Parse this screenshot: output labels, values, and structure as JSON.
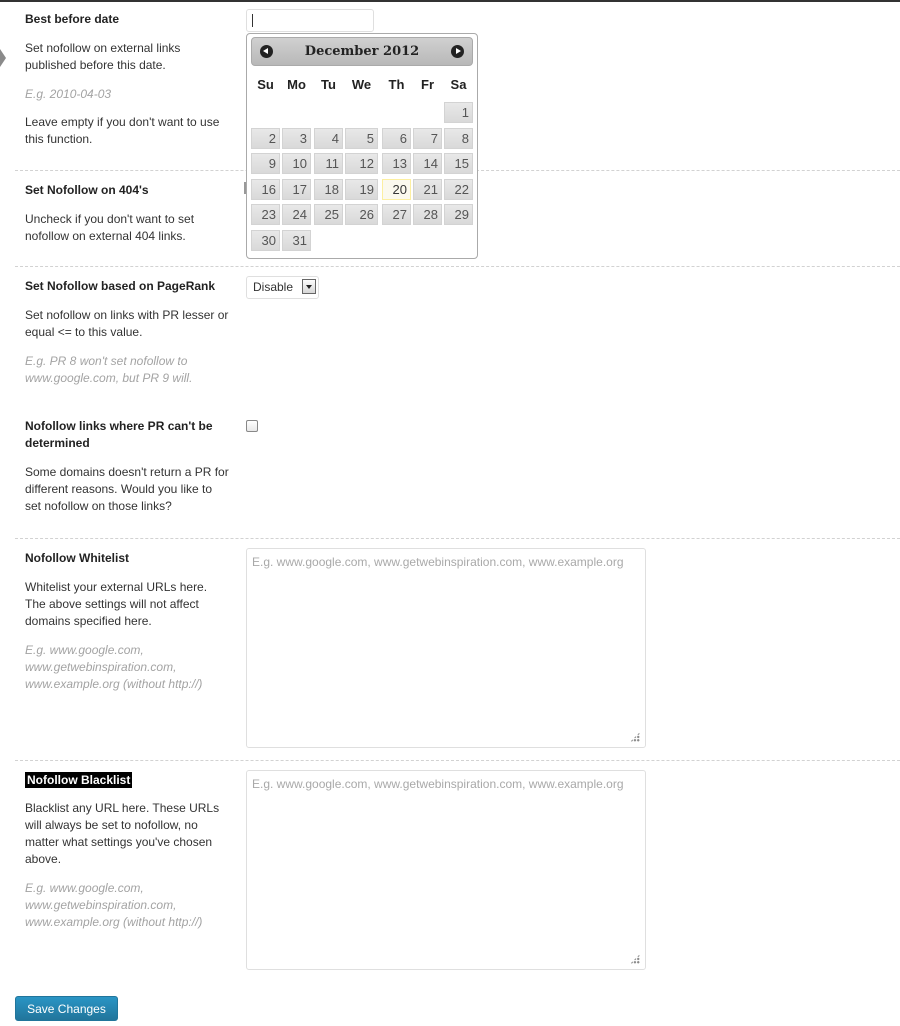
{
  "sections": {
    "best_before": {
      "title": "Best before date",
      "desc": "Set nofollow on external links published before this date.",
      "example": "E.g. 2010-04-03",
      "note": "Leave empty if you don't want to use this function.",
      "value": ""
    },
    "nofollow_404": {
      "title": "Set Nofollow on 404's",
      "desc": "Uncheck if you don't want to set nofollow on external 404 links."
    },
    "pagerank": {
      "title": "Set Nofollow based on PageRank",
      "desc": "Set nofollow on links with PR lesser or equal <= to this value.",
      "example": "E.g. PR 8 won't set nofollow to www.google.com, but PR 9 will.",
      "selected": "Disable"
    },
    "pr_undetermined": {
      "title": "Nofollow links where PR can't be determined",
      "desc": "Some domains doesn't return a PR for different reasons. Would you like to set nofollow on those links?"
    },
    "whitelist": {
      "title": "Nofollow Whitelist",
      "desc": "Whitelist your external URLs here. The above settings will not affect domains specified here.",
      "example": "E.g. www.google.com, www.getwebinspiration.com, www.example.org (without http://)",
      "placeholder": "E.g. www.google.com, www.getwebinspiration.com, www.example.org"
    },
    "blacklist": {
      "title": "Nofollow Blacklist",
      "desc": "Blacklist any URL here. These URLs will always be set to nofollow, no matter what settings you've chosen above.",
      "example": "E.g. www.google.com, www.getwebinspiration.com, www.example.org (without http://)",
      "placeholder": "E.g. www.google.com, www.getwebinspiration.com, www.example.org"
    }
  },
  "datepicker": {
    "month_label": "December 2012",
    "weekdays": [
      "Su",
      "Mo",
      "Tu",
      "We",
      "Th",
      "Fr",
      "Sa"
    ],
    "days": [
      "1",
      "2",
      "3",
      "4",
      "5",
      "6",
      "7",
      "8",
      "9",
      "10",
      "11",
      "12",
      "13",
      "14",
      "15",
      "16",
      "17",
      "18",
      "19",
      "20",
      "21",
      "22",
      "23",
      "24",
      "25",
      "26",
      "27",
      "28",
      "29",
      "30",
      "31"
    ],
    "first_weekday": 6,
    "today": 20
  },
  "buttons": {
    "save": "Save Changes"
  }
}
